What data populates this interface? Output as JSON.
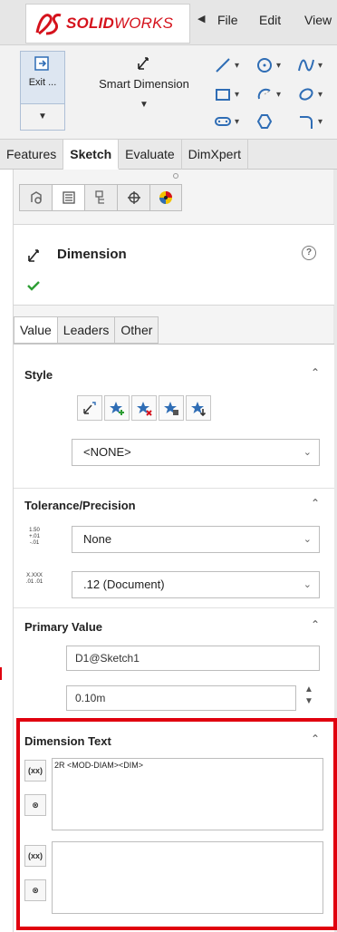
{
  "app": {
    "brand_bold": "SOLID",
    "brand_rest": "WORKS",
    "menu": [
      "File",
      "Edit",
      "View"
    ]
  },
  "ribbon": {
    "exit_label": "Exit ...",
    "smart_dimension_label": "Smart Dimension"
  },
  "command_tabs": [
    "Features",
    "Sketch",
    "Evaluate",
    "DimXpert"
  ],
  "command_tabs_active": "Sketch",
  "property_manager": {
    "title": "Dimension",
    "help": "?",
    "sub_tabs": [
      "Value",
      "Leaders",
      "Other"
    ],
    "sub_tabs_active": "Value",
    "style": {
      "title": "Style",
      "select_value": "<NONE>"
    },
    "tolerance": {
      "title": "Tolerance/Precision",
      "tolerance_icon_text": "1.50 +.01 -.01",
      "tolerance_value": "None",
      "precision_icon_text": "X.XXX .01 .01",
      "precision_value": ".12 (Document)"
    },
    "primary_value": {
      "title": "Primary Value",
      "name": "D1@Sketch1",
      "value": "0.10m"
    },
    "dimension_text": {
      "title": "Dimension Text",
      "text": "2R <MOD-DIAM><DIM>",
      "btn_add": "(xx)",
      "btn_clear": "⊗"
    }
  },
  "colors": {
    "brand_red": "#d5121c",
    "highlight_red": "#e0000f",
    "ok_green": "#2e9e34"
  }
}
